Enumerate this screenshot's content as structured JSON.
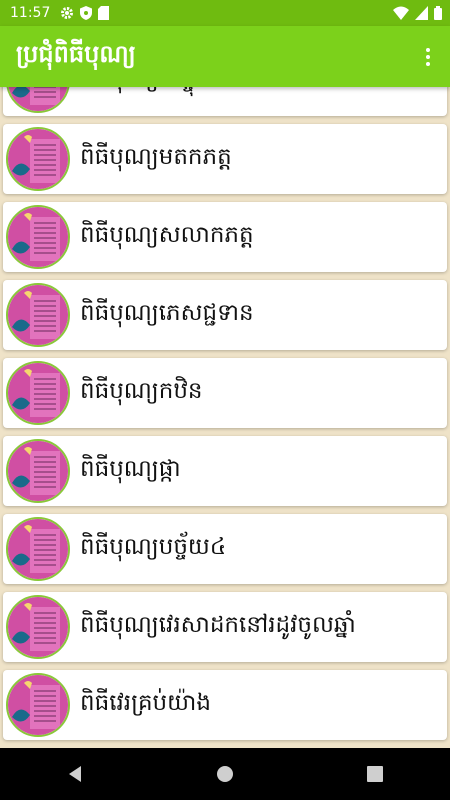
{
  "status_bar": {
    "time": "11:57",
    "icons": [
      "gear-icon",
      "shield-icon",
      "sd-card-icon",
      "wifi-icon",
      "signal-icon",
      "battery-icon"
    ]
  },
  "app_bar": {
    "title": "ប្រជុំពិធីបុណ្យ",
    "menu_icon": "more-vert-icon"
  },
  "items": [
    {
      "label": "ពិធីបុណ្យបញ្ចុះសីមា"
    },
    {
      "label": "ពិធីបុណ្យមតកភត្ត"
    },
    {
      "label": "ពិធីបុណ្យសលាកភត្ត"
    },
    {
      "label": "ពិធីបុណ្យភេសជ្ជទាន"
    },
    {
      "label": "ពិធីបុណ្យកឋិន"
    },
    {
      "label": "ពិធីបុណ្យផ្កា"
    },
    {
      "label": "ពិធីបុណ្យបច្ច័យ៤"
    },
    {
      "label": "ពិធីបុណ្យវេរសាដកនៅរដូវចូលឆ្នាំ"
    },
    {
      "label": "ពិធីវេរគ្រប់យ៉ាង"
    }
  ],
  "colors": {
    "app_bar": "#7cd11b",
    "status_bar": "#6fbb10",
    "background": "#efe3c8",
    "thumb_fill": "#d04fa3"
  },
  "nav": [
    "back-icon",
    "home-icon",
    "recents-icon"
  ]
}
